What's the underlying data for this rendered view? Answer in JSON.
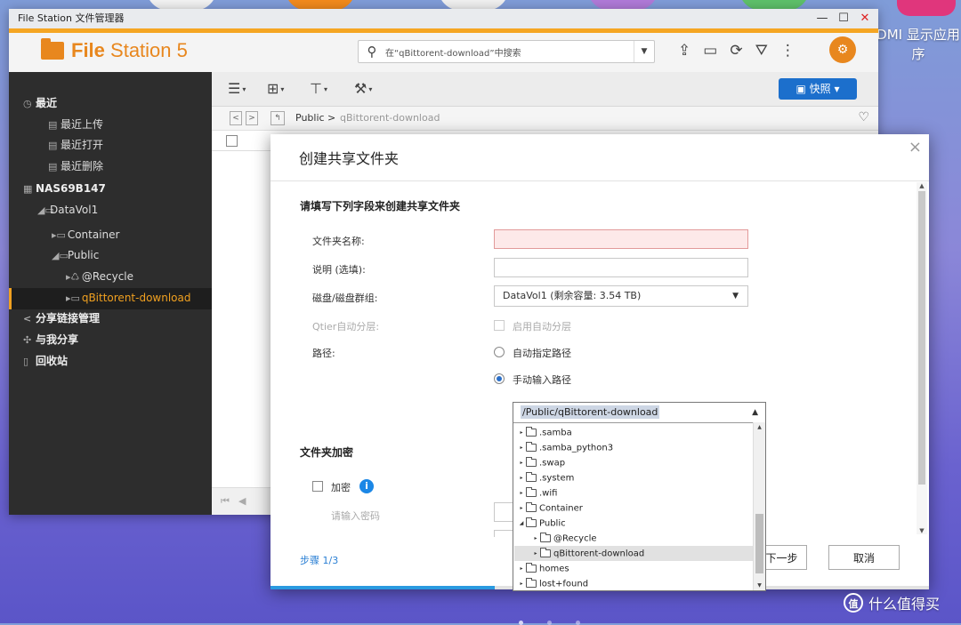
{
  "desktop": {
    "label_line1": "DMI 显示应用",
    "label_line2": "序",
    "watermark": "什么值得买",
    "watermark_logo": "值"
  },
  "window": {
    "title": "File Station 文件管理器",
    "app_name_bold": "File",
    "app_name_rest": "Station 5",
    "search_placeholder": "在“qBittorent-download”中搜索",
    "accent_color": "#f5a623"
  },
  "sidebar": {
    "recent": "最近",
    "recent_upload": "最近上传",
    "recent_open": "最近打开",
    "recent_delete": "最近删除",
    "nas": "NAS69B147",
    "datavol": "DataVol1",
    "container": "Container",
    "public": "Public",
    "recycle": "@Recycle",
    "qbit": "qBittorent-download",
    "share_link": "分享链接管理",
    "shared_with_me": "与我分享",
    "recycle_bin": "回收站"
  },
  "toolbar": {
    "snapshot": "快照"
  },
  "breadcrumb": {
    "root": "Public",
    "sep": ">",
    "current": "qBittorent-download"
  },
  "dialog": {
    "title": "创建共享文件夹",
    "close": "×",
    "section_title": "请填写下列字段来创建共享文件夹",
    "name_label": "文件夹名称:",
    "desc_label": "说明 (选填):",
    "disk_label": "磁盘/磁盘群组:",
    "disk_value": "DataVol1 (剩余容量:   3.54 TB)",
    "qtier_label": "Qtier自动分层:",
    "qtier_option": "启用自动分层",
    "path_label": "路径:",
    "path_auto": "自动指定路径",
    "path_manual": "手动输入路径",
    "encrypt_section": "文件夹加密",
    "encrypt_label": "加密",
    "password_placeholder": "请输入密码",
    "step": "步骤 1/3",
    "next": "下一步",
    "cancel": "取消",
    "progress_fraction": 0.34
  },
  "path_dropdown": {
    "value": "/Public/qBittorent-download",
    "items": [
      {
        "name": ".samba",
        "level": 0,
        "expanded": false,
        "selected": false
      },
      {
        "name": ".samba_python3",
        "level": 0,
        "expanded": false,
        "selected": false
      },
      {
        "name": ".swap",
        "level": 0,
        "expanded": false,
        "selected": false
      },
      {
        "name": ".system",
        "level": 0,
        "expanded": false,
        "selected": false
      },
      {
        "name": ".wifi",
        "level": 0,
        "expanded": false,
        "selected": false
      },
      {
        "name": "Container",
        "level": 0,
        "expanded": false,
        "selected": false
      },
      {
        "name": "Public",
        "level": 0,
        "expanded": true,
        "selected": false
      },
      {
        "name": "@Recycle",
        "level": 1,
        "expanded": false,
        "selected": false
      },
      {
        "name": "qBittorent-download",
        "level": 1,
        "expanded": false,
        "selected": true
      },
      {
        "name": "homes",
        "level": 0,
        "expanded": false,
        "selected": false
      },
      {
        "name": "lost+found",
        "level": 0,
        "expanded": false,
        "selected": false
      }
    ]
  }
}
